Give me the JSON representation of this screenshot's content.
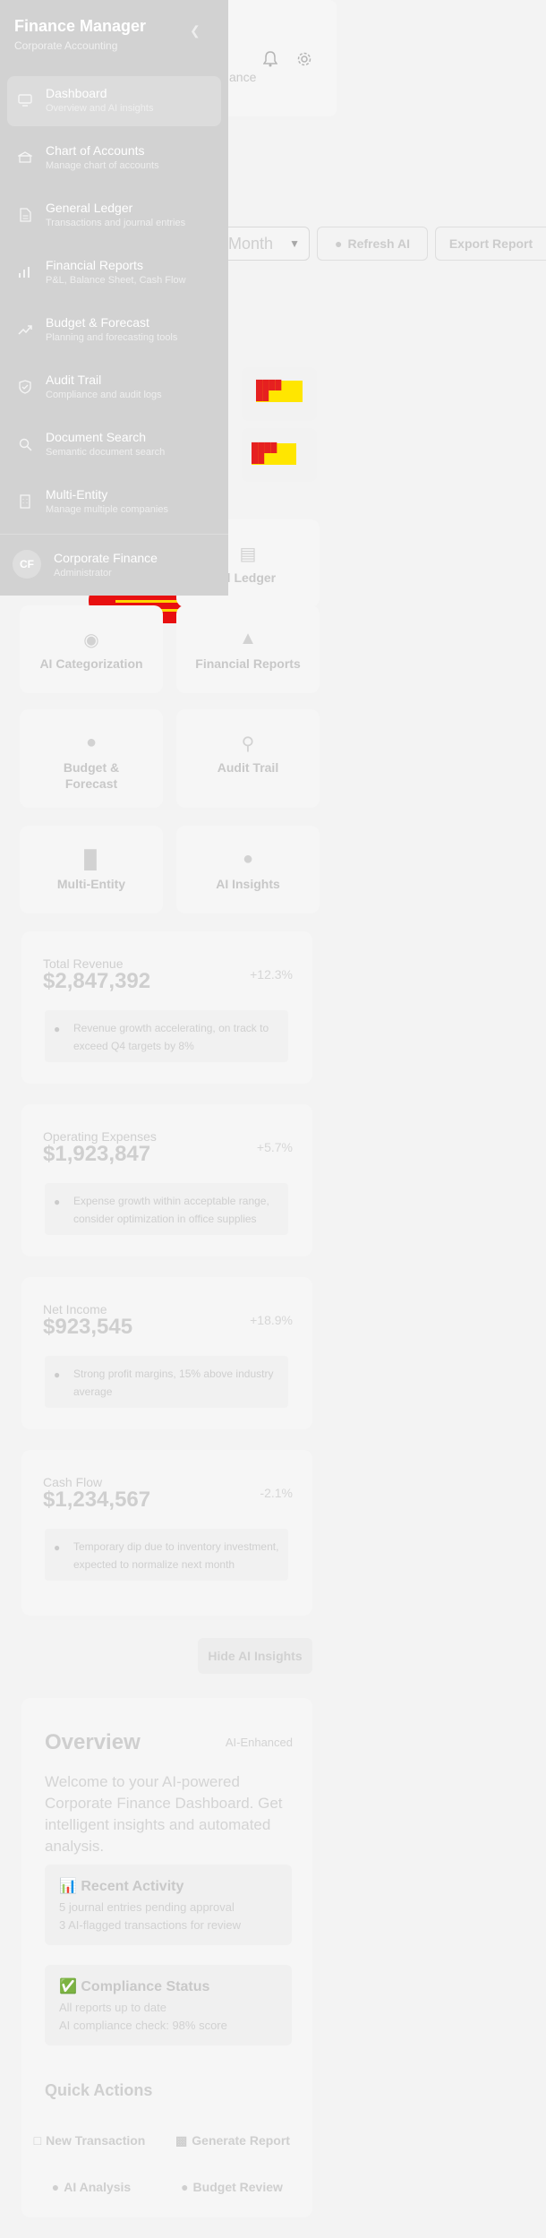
{
  "sidebar": {
    "title": "Finance Manager",
    "subtitle": "Corporate Accounting",
    "collapse_icon": "chevron-left-icon",
    "items": [
      {
        "label": "Dashboard",
        "desc": "Overview and AI insights",
        "icon": "dashboard-icon",
        "active": true
      },
      {
        "label": "Chart of Accounts",
        "desc": "Manage chart of accounts",
        "icon": "bank-icon"
      },
      {
        "label": "General Ledger",
        "desc": "Transactions and journal entries",
        "icon": "document-icon"
      },
      {
        "label": "Financial Reports",
        "desc": "P&L, Balance Sheet, Cash Flow",
        "icon": "bar-chart-icon"
      },
      {
        "label": "Budget & Forecast",
        "desc": "Planning and forecasting tools",
        "icon": "trend-up-icon"
      },
      {
        "label": "Audit Trail",
        "desc": "Compliance and audit logs",
        "icon": "shield-icon"
      },
      {
        "label": "Document Search",
        "desc": "Semantic document search",
        "icon": "search-icon"
      },
      {
        "label": "Multi-Entity",
        "desc": "Manage multiple companies",
        "icon": "building-icon"
      }
    ],
    "user": {
      "initials": "CF",
      "name": "Corporate Finance",
      "role": "Administrator"
    }
  },
  "header": {
    "subtitle_fragment": "ance",
    "bell_icon": "bell-icon",
    "settings_icon": "gear-icon"
  },
  "toolbar": {
    "period_value": "Month",
    "refresh_label": "Refresh AI",
    "export_label": "Export Report"
  },
  "nav_cards": [
    {
      "label": "al Ledger",
      "icon": "ledger-icon"
    },
    {
      "label": "AI Categorization",
      "icon": "tag-icon"
    },
    {
      "label": "Financial Reports",
      "icon": "chart-icon"
    },
    {
      "label": "Budget & Forecast",
      "icon": "money-bag-icon"
    },
    {
      "label": "Audit Trail",
      "icon": "magnifier-icon"
    },
    {
      "label": "Multi-Entity",
      "icon": "building-icon"
    },
    {
      "label": "AI Insights",
      "icon": "robot-icon"
    }
  ],
  "metrics": [
    {
      "title": "Total Revenue",
      "value": "$2,847,392",
      "change": "+12.3%",
      "insight": "Revenue growth accelerating, on track to exceed Q4 targets by 8%"
    },
    {
      "title": "Operating Expenses",
      "value": "$1,923,847",
      "change": "+5.7%",
      "insight": "Expense growth within acceptable range, consider optimization in office supplies"
    },
    {
      "title": "Net Income",
      "value": "$923,545",
      "change": "+18.9%",
      "insight": "Strong profit margins, 15% above industry average"
    },
    {
      "title": "Cash Flow",
      "value": "$1,234,567",
      "change": "-2.1%",
      "insight": "Temporary dip due to inventory investment, expected to normalize next month"
    }
  ],
  "hide_ai_label": "Hide AI Insights",
  "overview": {
    "title": "Overview",
    "tag": "AI-Enhanced",
    "description": "Welcome to your AI-powered Corporate Finance Dashboard. Get intelligent insights and automated analysis.",
    "recent": {
      "title": "📊 Recent Activity",
      "lines": [
        "5 journal entries pending approval",
        "3 AI-flagged transactions for review"
      ]
    },
    "compliance": {
      "title": "✅ Compliance Status",
      "lines": [
        "All reports up to date",
        "AI compliance check: 98% score"
      ]
    },
    "quick_title": "Quick Actions",
    "actions": [
      "New Transaction",
      "Generate Report",
      "AI Analysis",
      "Budget Review"
    ]
  },
  "colors": {
    "sidebar_bg": "#d2d2d2",
    "alert_red": "#e81010",
    "alert_yellow": "#ffe600"
  }
}
